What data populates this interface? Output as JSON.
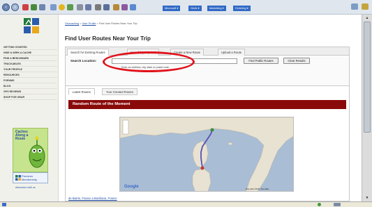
{
  "browser": {
    "bookmarks": [
      "Microsoft ▾",
      "Geek ▾",
      "Marketing ▾",
      "Ordering ▾"
    ]
  },
  "sidebar": {
    "items": [
      "Getting Started",
      "Hide & Seek a Cache",
      "Find a Benchmark",
      "Trackables",
      "Your Profile",
      "Resources",
      "Forums",
      "Blog",
      "GPS Reviews",
      "Shop for Gear"
    ],
    "promo": {
      "title": "Caches Along a Route"
    },
    "promo2": {
      "text": "Premium Membership"
    },
    "promo_url": "Adventure with us"
  },
  "breadcrumb": {
    "part1": "Geocaching",
    "sep": " > ",
    "part2": "User Profile",
    "rest": " > Find User Routes Near Your Trip"
  },
  "page": {
    "title": "Find User Routes Near Your Trip"
  },
  "search": {
    "tabs": [
      "Search for Existing Routes",
      "Search by Keyword",
      "Create a New Route",
      "Upload a Route"
    ],
    "label": "Search Location:",
    "input_value": "",
    "hint": "Enter an address, city, state or postal code.",
    "buttons": {
      "find": "Find Public Routes",
      "clear": "Clear Results"
    }
  },
  "results": {
    "tabs": [
      "Latest Routes",
      "Your Created Routes"
    ],
    "banner": "Random Route of the Moment",
    "map_logo": "Google",
    "map_attrib": "Map data ©2011 Tele Atlas",
    "route_link": "de Barrie, France a Bonifacio, France"
  },
  "colors": {
    "banner": "#8a0a0a",
    "annotation": "#e0121b",
    "sea": "#a9bdd4",
    "land": "#e8e2d2",
    "route": "#5a4fb0"
  }
}
